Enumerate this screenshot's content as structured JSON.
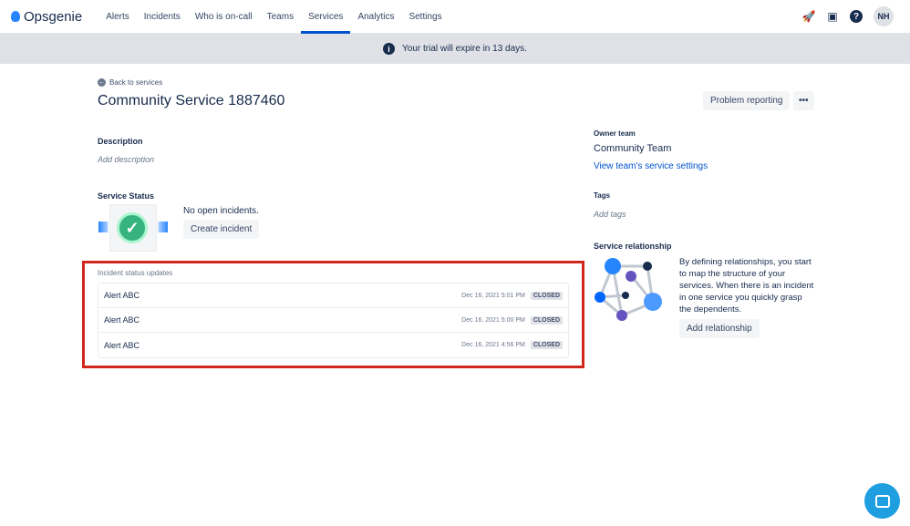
{
  "nav": {
    "brand": "Opsgenie",
    "items": [
      "Alerts",
      "Incidents",
      "Who is on-call",
      "Teams",
      "Services",
      "Analytics",
      "Settings"
    ],
    "active": "Services",
    "avatar": "NH"
  },
  "banner": {
    "text": "Your trial will expire in 13 days."
  },
  "page": {
    "back": "Back to services",
    "title": "Community Service 1887460",
    "problem_reporting": "Problem reporting"
  },
  "description": {
    "label": "Description",
    "placeholder": "Add description"
  },
  "status": {
    "label": "Service Status",
    "text": "No open incidents.",
    "create": "Create incident"
  },
  "updates": {
    "title": "Incident status updates",
    "rows": [
      {
        "name": "Alert ABC",
        "date": "Dec 16, 2021 5:01 PM",
        "status": "CLOSED"
      },
      {
        "name": "Alert ABC",
        "date": "Dec 16, 2021 5:00 PM",
        "status": "CLOSED"
      },
      {
        "name": "Alert ABC",
        "date": "Dec 16, 2021 4:56 PM",
        "status": "CLOSED"
      }
    ]
  },
  "owner": {
    "label": "Owner team",
    "team": "Community Team",
    "link": "View team's service settings"
  },
  "tags": {
    "label": "Tags",
    "placeholder": "Add tags"
  },
  "relationship": {
    "label": "Service relationship",
    "text": "By defining relationships, you start to map the structure of your services. When there is an incident in one service you quickly grasp the dependents.",
    "button": "Add relationship"
  }
}
